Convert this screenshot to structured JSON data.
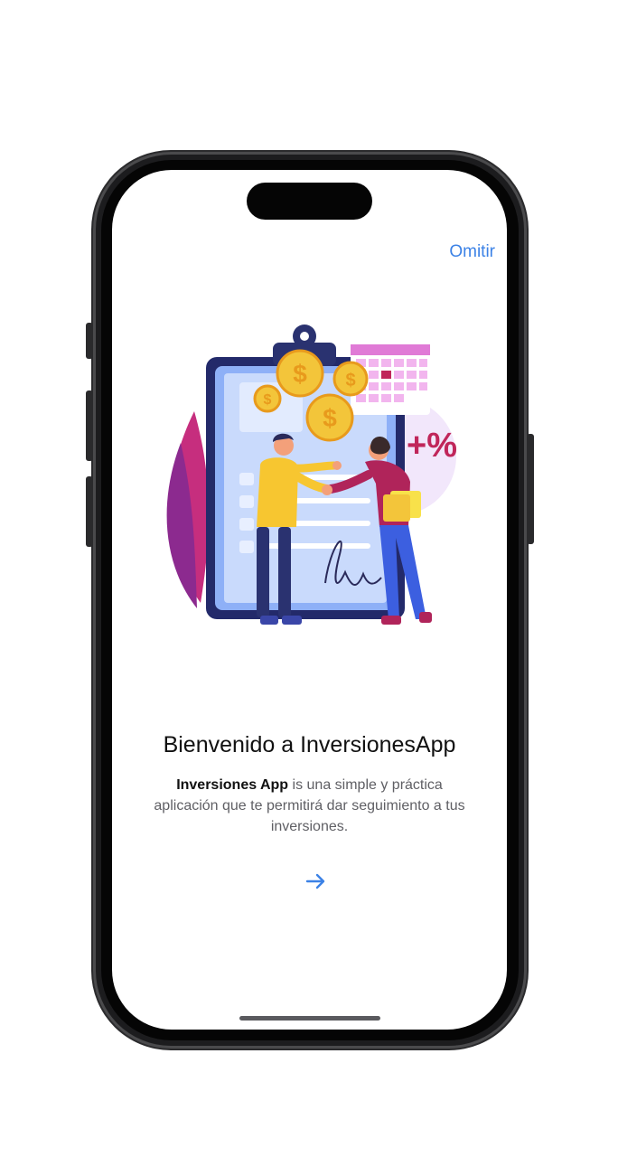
{
  "header": {
    "skip_label": "Omitir"
  },
  "onboarding": {
    "title": "Bienvenido a InversionesApp",
    "description_brand": "Inversiones App",
    "description_rest": " is una simple y práctica aplicación que te permitirá dar seguimiento a tus inversiones.",
    "illustration_badge": "+%",
    "next_icon": "arrow-right-icon"
  },
  "colors": {
    "accent": "#3c82e6",
    "title": "#111111",
    "body_text": "#5f5f64",
    "badge": "#c0265a",
    "calendar": "#e07ad6",
    "clipboard": "#7fa3f5"
  }
}
